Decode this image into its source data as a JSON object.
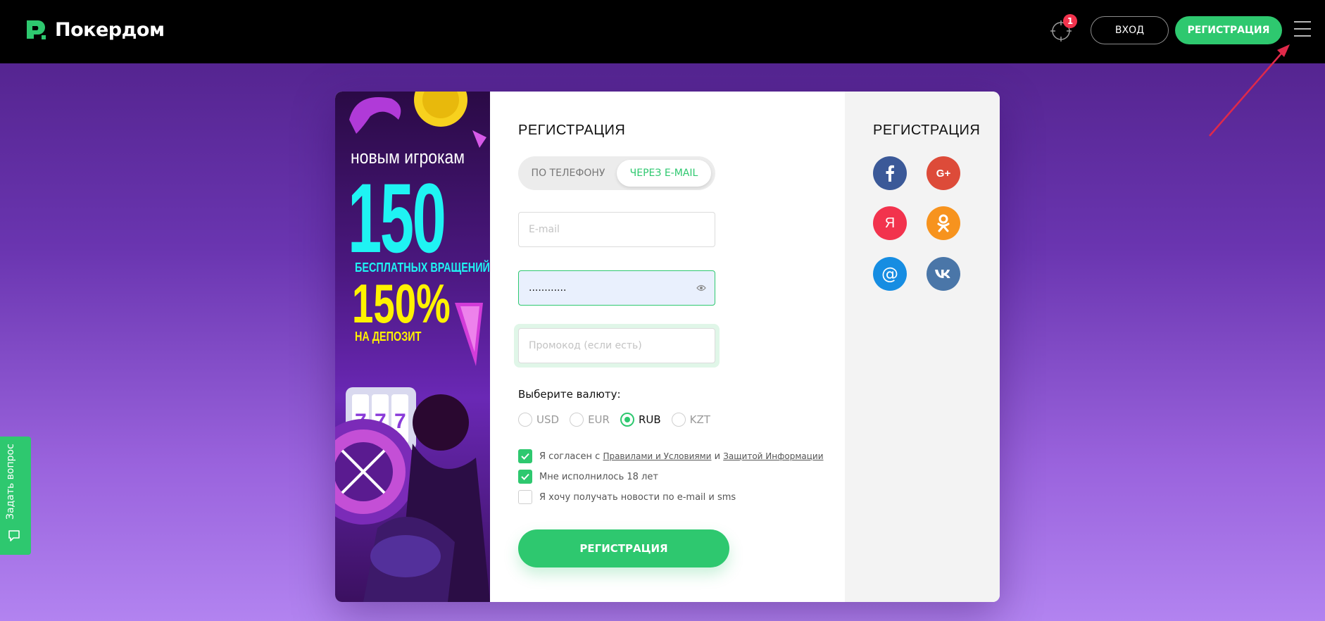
{
  "header": {
    "logo_text": "Покердом",
    "notification_count": "1",
    "login_label": "ВХОД",
    "register_label": "РЕГИСТРАЦИЯ"
  },
  "promo_banner": {
    "line1": "новым игрокам",
    "spins_number": "150",
    "spins_label": "БЕСПЛАТНЫХ ВРАЩЕНИЙ",
    "bonus_percent": "150%",
    "bonus_label": "НА ДЕПОЗИТ"
  },
  "form": {
    "title": "РЕГИСТРАЦИЯ",
    "tabs": [
      {
        "label": "ПО ТЕЛЕФОНУ",
        "active": false
      },
      {
        "label": "ЧЕРЕЗ E-MAIL",
        "active": true
      }
    ],
    "email_placeholder": "E-mail",
    "email_value": "",
    "password_value": "............",
    "promo_placeholder": "Промокод (если есть)",
    "currency_label": "Выберите валюту:",
    "currencies": [
      {
        "label": "USD",
        "selected": false
      },
      {
        "label": "EUR",
        "selected": false
      },
      {
        "label": "RUB",
        "selected": true
      },
      {
        "label": "KZT",
        "selected": false
      }
    ],
    "agree_prefix": "Я согласен с",
    "rules_link": "Правилами и Условиями",
    "agree_and": "и",
    "privacy_link": "Защитой Информации",
    "agree_checked": true,
    "age_text": "Мне исполнилось 18 лет",
    "age_checked": true,
    "news_text": "Я хочу получать новости по e-mail и sms",
    "news_checked": false,
    "submit_label": "РЕГИСТРАЦИЯ"
  },
  "social": {
    "title": "РЕГИСТРАЦИЯ",
    "providers": [
      {
        "name": "facebook",
        "glyph": "f",
        "color": "#3b5998"
      },
      {
        "name": "google-plus",
        "glyph": "G+",
        "color": "#dd4b39"
      },
      {
        "name": "yandex",
        "glyph": "Я",
        "color": "#f2334d"
      },
      {
        "name": "odnoklassniki",
        "glyph": "ok",
        "color": "#f7931e"
      },
      {
        "name": "mail-ru",
        "glyph": "@",
        "color": "#168de2"
      },
      {
        "name": "vkontakte",
        "glyph": "vk",
        "color": "#4a76a8"
      }
    ]
  },
  "side_tab": {
    "label": "Задать вопрос"
  },
  "colors": {
    "accent": "#2ec86f",
    "header_bg": "#000000",
    "badge": "#f2334d"
  }
}
